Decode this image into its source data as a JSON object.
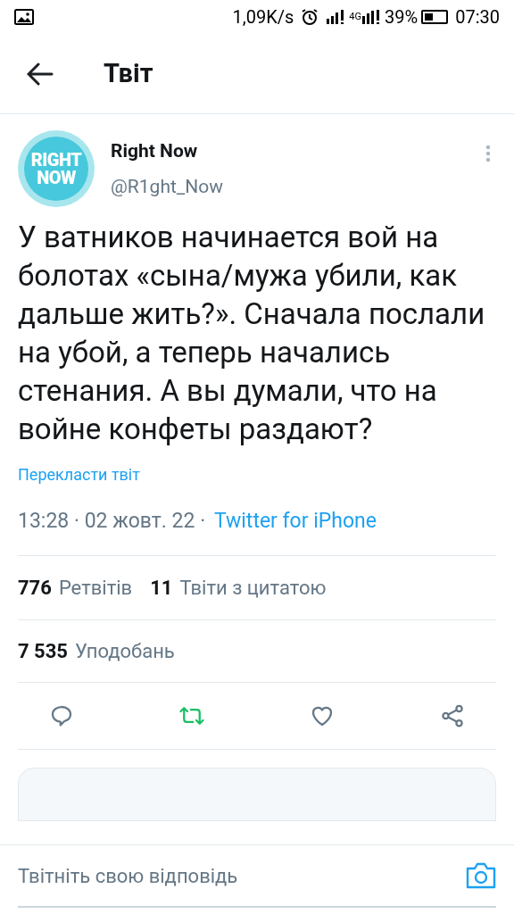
{
  "status_bar": {
    "speed": "1,09K/s",
    "network": "4G",
    "battery": "39%",
    "time": "07:30"
  },
  "header": {
    "title": "Твіт"
  },
  "tweet": {
    "avatar_text": [
      "RIGHT",
      "NOW"
    ],
    "name": "Right Now",
    "handle": "@R1ght_Now",
    "text": "У ватников начинается вой на болотах «сына/мужа убили, как дальше жить?». Сначала послали на убой, а теперь начались стенания. А вы думали, что на войне конфеты раздают?",
    "translate": "Перекласти твіт",
    "date": "13:28 · 02 жовт. 22 · ",
    "source": "Twitter for iPhone",
    "stats": [
      {
        "count": "776",
        "label": "Ретвітів"
      },
      {
        "count": "11",
        "label": "Твіти з цитатою"
      }
    ],
    "likes": {
      "count": "7 535",
      "label": "Уподобань"
    },
    "actions": [
      {
        "kind": "reply",
        "active": false
      },
      {
        "kind": "retweet",
        "active": true
      },
      {
        "kind": "like",
        "active": false
      },
      {
        "kind": "share",
        "active": false
      }
    ]
  },
  "reply_bar": {
    "placeholder": "Твітніть свою відповідь"
  }
}
